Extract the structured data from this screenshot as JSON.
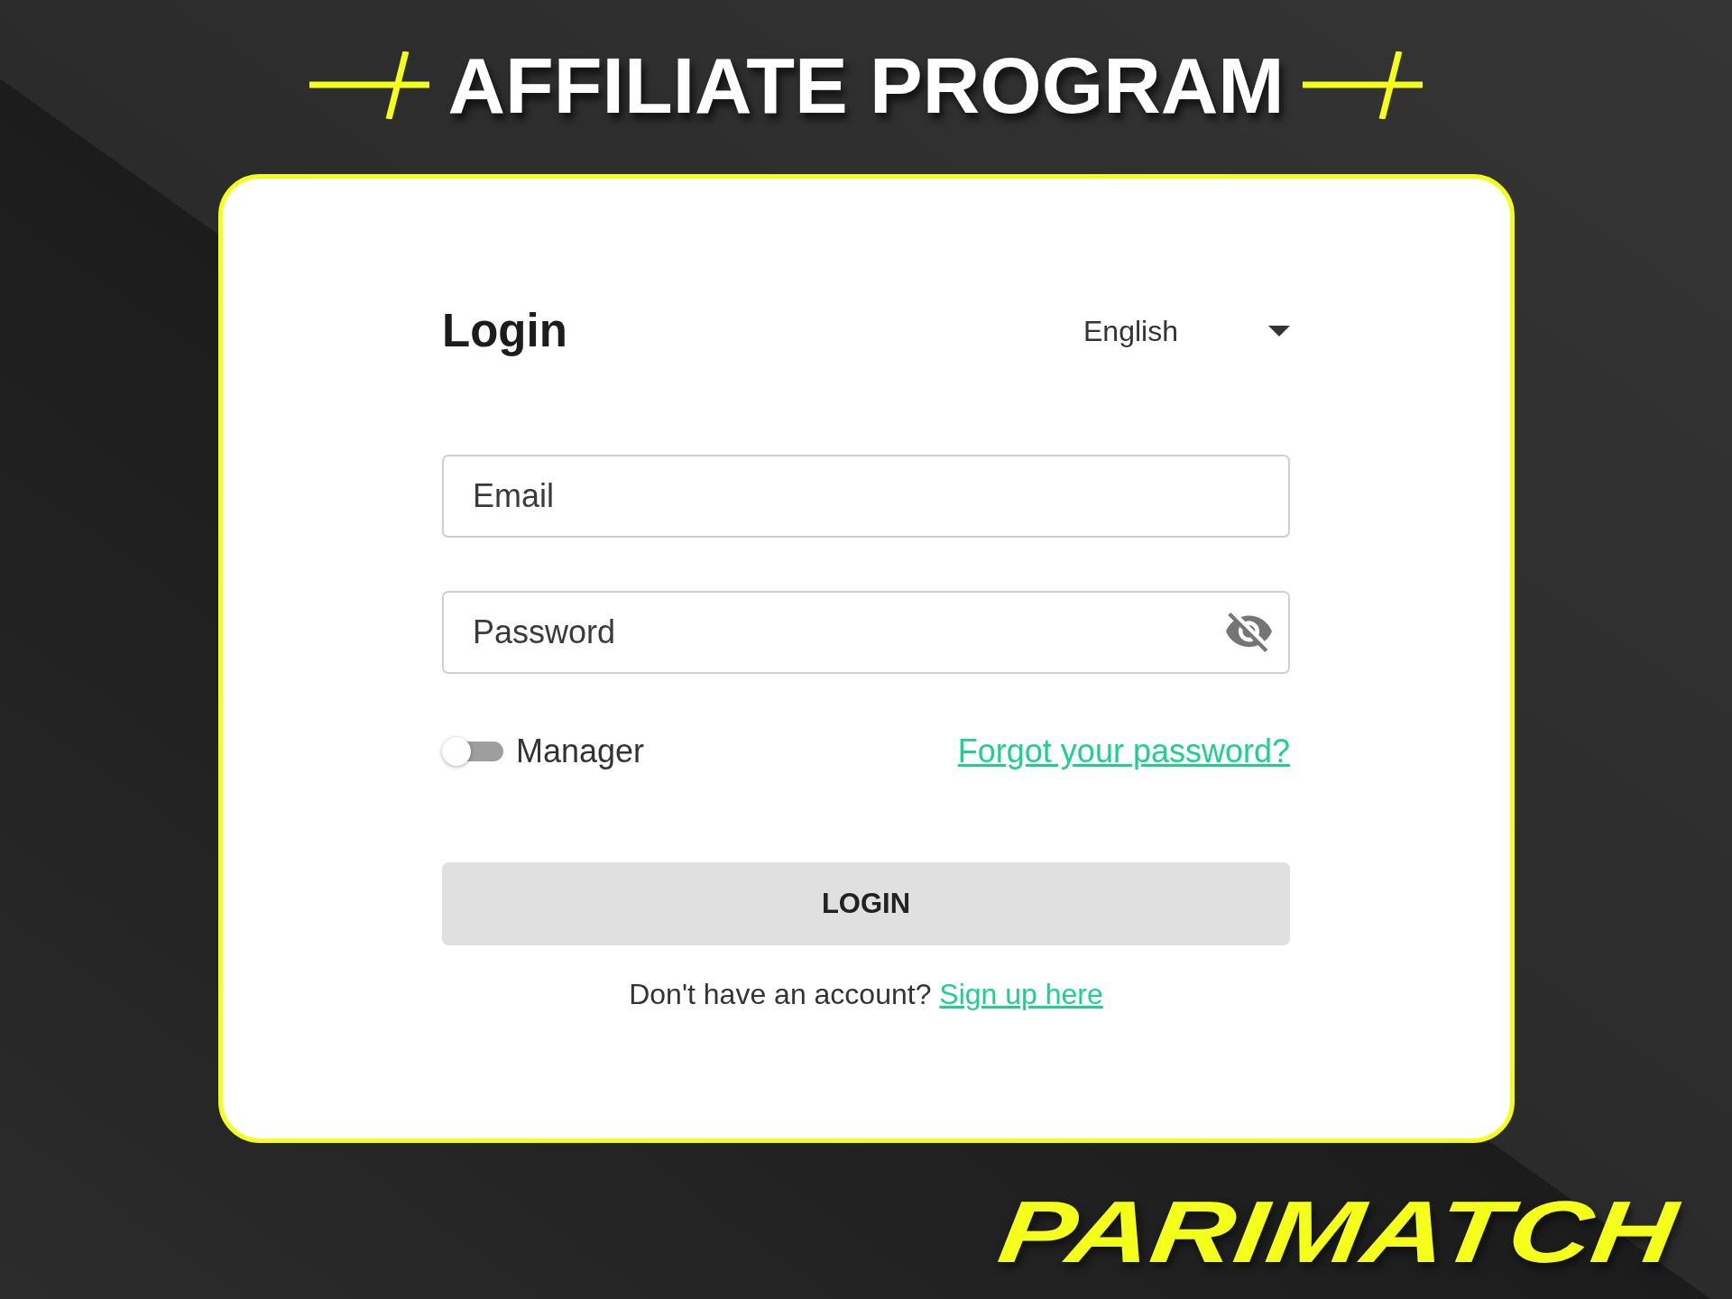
{
  "header": {
    "title": "AFFILIATE PROGRAM"
  },
  "login_form": {
    "title": "Login",
    "language": "English",
    "fields": [
      {
        "kind": "email",
        "placeholder": "Email"
      },
      {
        "kind": "password",
        "placeholder": "Password",
        "revealed": false
      }
    ],
    "manager_toggle": {
      "label": "Manager",
      "on": false
    },
    "forgot_link": "Forgot your password?",
    "submit_button": "LOGIN",
    "signup": {
      "prompt": "Don't have an account?",
      "link": "Sign up here"
    }
  },
  "brand": {
    "logo": "PARIMATCH"
  }
}
